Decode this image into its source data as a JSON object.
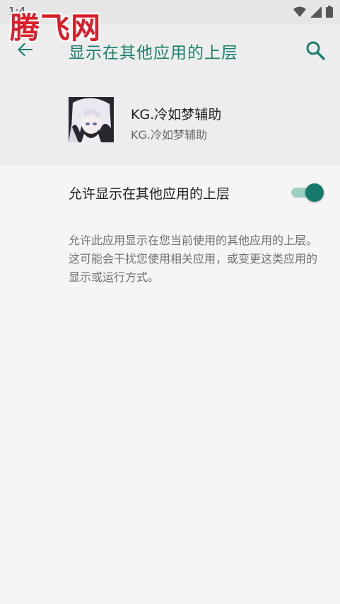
{
  "status_bar": {
    "time": "1:4",
    "icons": [
      "notification-icon",
      "wifi-icon",
      "signal-icon",
      "battery-icon"
    ]
  },
  "watermark": {
    "text": "腾飞网"
  },
  "toolbar": {
    "title": "显示在其他应用的上层",
    "back_icon": "arrow-back-icon",
    "search_icon": "search-icon"
  },
  "app": {
    "name": "KG.冷如梦辅助",
    "package": "KG.冷如梦辅助"
  },
  "setting": {
    "label": "允许显示在其他应用的上层",
    "enabled": true
  },
  "description": "允许此应用显示在您当前使用的其他应用的上层。这可能会干扰您使用相关应用，或变更这类应用的显示或运行方式。",
  "colors": {
    "accent": "#1a7f6f",
    "toggle_thumb": "#167a6a",
    "toggle_track": "#9fcfc4",
    "watermark": "#d7202a"
  }
}
